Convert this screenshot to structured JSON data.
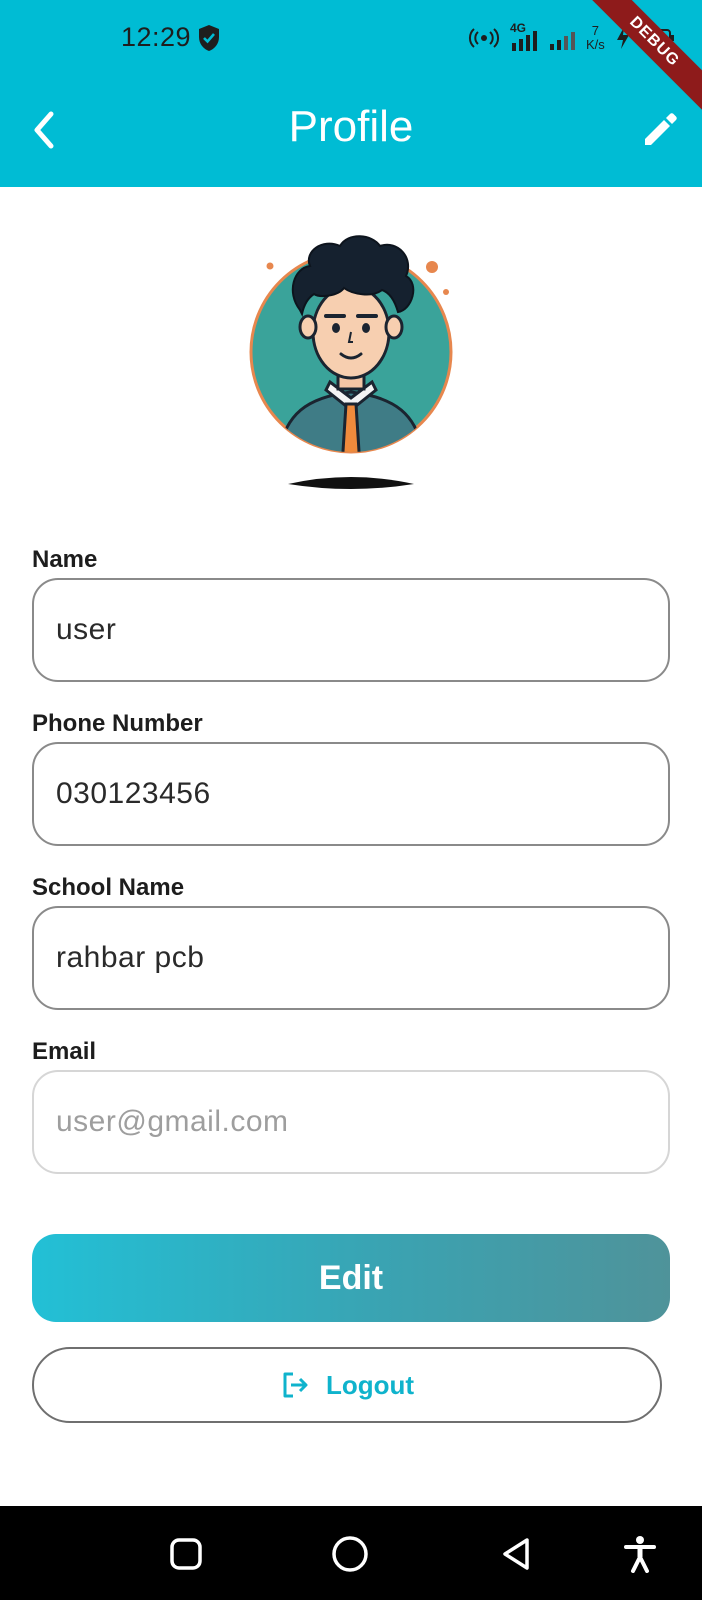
{
  "status_bar": {
    "time": "12:29",
    "net_speed_value": "7",
    "net_speed_unit": "K/s",
    "network_type": "4G",
    "debug_banner": "DEBUG"
  },
  "app_bar": {
    "title": "Profile",
    "back_icon": "chevron-left-icon",
    "edit_icon": "pencil-icon"
  },
  "colors": {
    "primary": "#00bcd4",
    "button_gradient_start": "#22c0d6",
    "button_gradient_end": "#4f939a",
    "logout_text": "#0fb3cc"
  },
  "form": {
    "name": {
      "label": "Name",
      "value": "user"
    },
    "phone": {
      "label": "Phone Number",
      "value": "030123456"
    },
    "school": {
      "label": "School Name",
      "value": "rahbar pcb"
    },
    "email": {
      "label": "Email",
      "value": "user@gmail.com"
    }
  },
  "actions": {
    "edit_label": "Edit",
    "logout_label": "Logout",
    "logout_icon": "logout-icon"
  },
  "nav_bar": {
    "recents": "square-icon",
    "home": "circle-icon",
    "back": "triangle-back-icon",
    "accessibility": "accessibility-icon"
  }
}
